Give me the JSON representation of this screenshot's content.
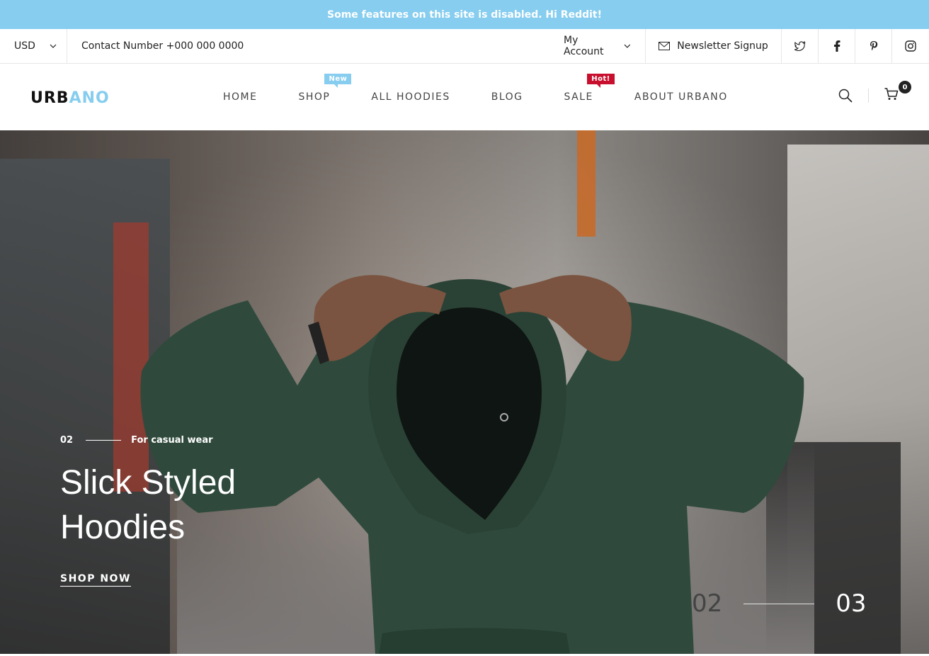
{
  "announcement": "Some features on this site is disabled. Hi Reddit!",
  "topbar": {
    "currency": "USD",
    "contact": "Contact Number +000 000 0000",
    "account": "My Account",
    "newsletter": "Newsletter Signup",
    "social": [
      "twitter-icon",
      "facebook-icon",
      "pinterest-icon",
      "instagram-icon"
    ]
  },
  "logo": {
    "part1": "URB",
    "part2": "ANO",
    "full": "URBANO"
  },
  "nav": {
    "items": [
      {
        "label": "HOME"
      },
      {
        "label": "SHOP",
        "badge": "New"
      },
      {
        "label": "ALL HOODIES"
      },
      {
        "label": "BLOG"
      },
      {
        "label": "SALE",
        "badge": "Hot!"
      },
      {
        "label": "ABOUT URBANO"
      }
    ],
    "cart_count": "0"
  },
  "hero": {
    "slide_number": "02",
    "tagline": "For casual wear",
    "title_line1": "Slick Styled",
    "title_line2": "Hoodies",
    "cta": "SHOP NOW",
    "current_slide": "02",
    "next_slide": "03"
  },
  "colors": {
    "accent": "#86cdef",
    "hot": "#c8102e",
    "hoodie": "#2f4a3c"
  }
}
